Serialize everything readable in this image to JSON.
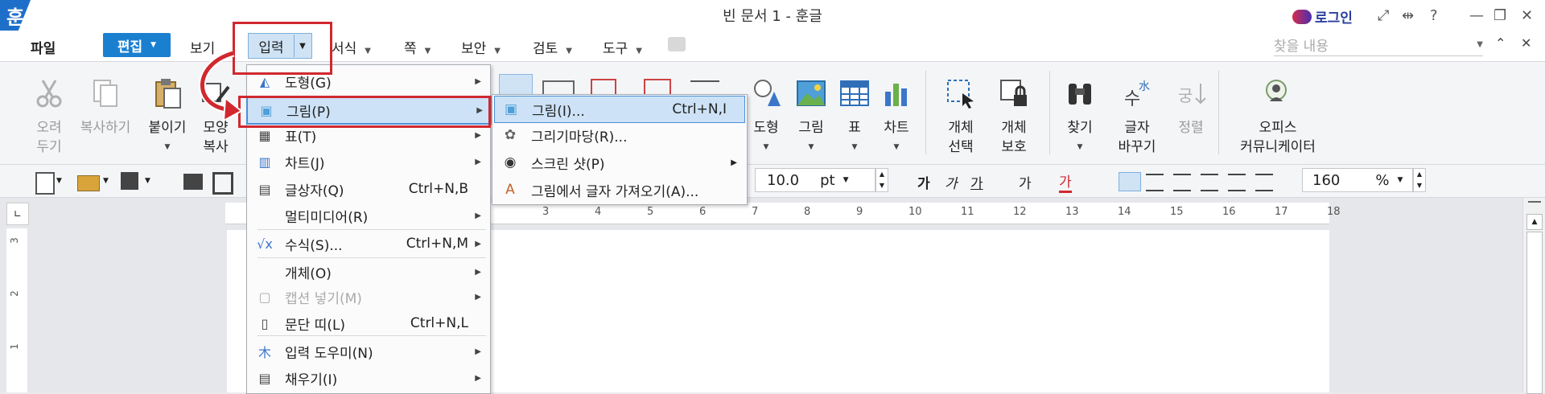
{
  "app": {
    "logo_char": "훈",
    "title": "빈 문서 1 - 훈글",
    "login_label": "로그인"
  },
  "menubar": {
    "file": "파일",
    "edit": "편집",
    "view": "보기",
    "input": "입력",
    "format": "서식",
    "page": "쪽",
    "security": "보안",
    "review": "검토",
    "tools": "도구",
    "search_placeholder": "찾을 내용"
  },
  "ribbon": {
    "cut": [
      "오려",
      "두기"
    ],
    "copy": "복사하기",
    "paste": "붙이기",
    "shape_copy": [
      "모양",
      "복사"
    ],
    "shape": "도형",
    "picture": "그림",
    "table": "표",
    "chart": "차트",
    "object_select": [
      "개체",
      "선택"
    ],
    "object_protect": [
      "개체",
      "보호"
    ],
    "find": "찾기",
    "replace": [
      "글자",
      "바꾸기"
    ],
    "tidy": "정렬",
    "office_communicator": [
      "오피스",
      "커뮤니케이터"
    ]
  },
  "format_bar": {
    "font_size": "10.0",
    "font_unit": "pt",
    "zoom": "160",
    "zoom_unit": "%"
  },
  "ruler_ticks": [
    "3",
    "4",
    "5",
    "6",
    "7",
    "8",
    "9",
    "10",
    "11",
    "12",
    "13",
    "14",
    "15",
    "16",
    "17",
    "18"
  ],
  "vruler_ticks": [
    "3",
    "2",
    "1"
  ],
  "input_menu": [
    {
      "label": "도형(G)",
      "shortcut": "",
      "submenu": true
    },
    {
      "label": "그림(P)",
      "shortcut": "",
      "submenu": true
    },
    {
      "label": "표(T)",
      "shortcut": "",
      "submenu": true
    },
    {
      "label": "차트(J)",
      "shortcut": "",
      "submenu": true
    },
    {
      "label": "글상자(Q)",
      "shortcut": "Ctrl+N,B",
      "submenu": false
    },
    {
      "label": "멀티미디어(R)",
      "shortcut": "",
      "submenu": true
    },
    {
      "label": "수식(S)...",
      "shortcut": "Ctrl+N,M",
      "submenu": true
    },
    {
      "label": "개체(O)",
      "shortcut": "",
      "submenu": true
    },
    {
      "label": "캡션 넣기(M)",
      "shortcut": "",
      "submenu": true
    },
    {
      "label": "문단 띠(L)",
      "shortcut": "Ctrl+N,L",
      "submenu": false
    },
    {
      "label": "입력 도우미(N)",
      "shortcut": "",
      "submenu": true
    },
    {
      "label": "채우기(I)",
      "shortcut": "",
      "submenu": true
    }
  ],
  "picture_submenu": [
    {
      "label": "그림(I)...",
      "shortcut": "Ctrl+N,I"
    },
    {
      "label": "그리기마당(R)...",
      "shortcut": ""
    },
    {
      "label": "스크린 샷(P)",
      "shortcut": ""
    },
    {
      "label": "그림에서 글자 가져오기(A)...",
      "shortcut": ""
    }
  ],
  "colors": {
    "accent": "#1b7fd0",
    "highlight": "#cde2f6",
    "annotation_red": "#d0282e"
  }
}
